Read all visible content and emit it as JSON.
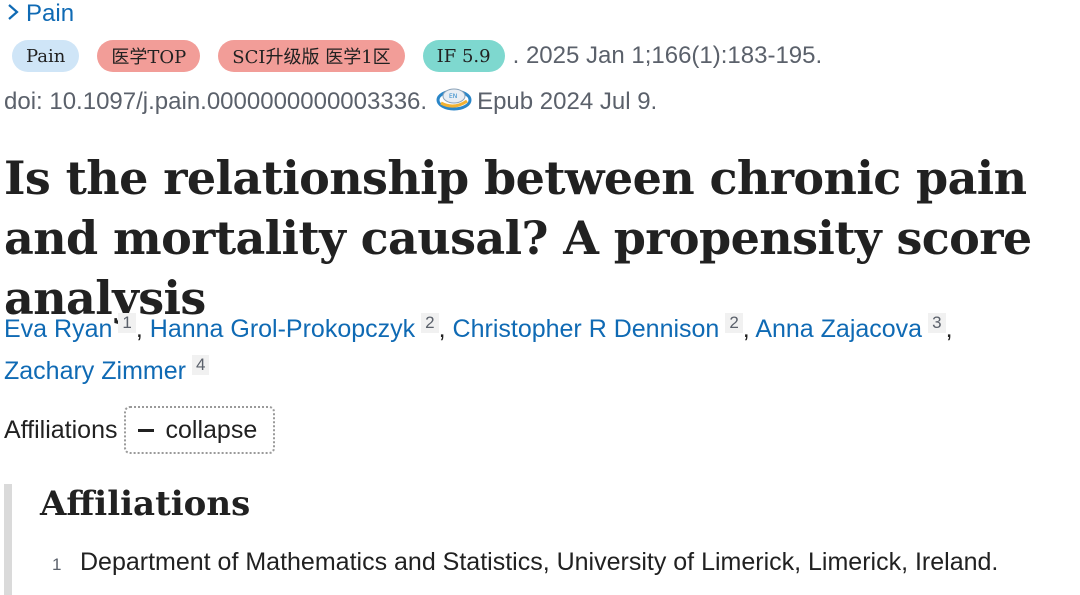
{
  "journal": {
    "link_label": "Pain"
  },
  "badges": {
    "journal": "Pain",
    "top": "医学TOP",
    "sci": "SCI升级版 医学1区",
    "if": "IF 5.9"
  },
  "citation": {
    "text": ". 2025 Jan 1;166(1):183-195."
  },
  "doi": {
    "text": "doi: 10.1097/j.pain.0000000000003336.",
    "epub": "Epub 2024 Jul 9."
  },
  "title": "Is the relationship between chronic pain and mortality causal? A propensity score analysis",
  "authors": [
    {
      "name": "Eva Ryan",
      "aff": "1"
    },
    {
      "name": "Hanna Grol-Prokopczyk",
      "aff": "2"
    },
    {
      "name": "Christopher R Dennison",
      "aff": "2"
    },
    {
      "name": "Anna Zajacova",
      "aff": "3"
    },
    {
      "name": "Zachary Zimmer",
      "aff": "4"
    }
  ],
  "affiliations_toggle": {
    "label": "Affiliations",
    "button": "collapse"
  },
  "affiliations": {
    "heading": "Affiliations",
    "items": [
      {
        "num": "1",
        "text": "Department of Mathematics and Statistics, University of Limerick, Limerick, Ireland."
      }
    ]
  }
}
